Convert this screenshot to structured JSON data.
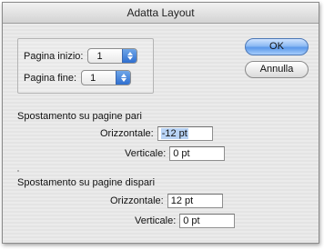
{
  "window": {
    "title": "Adatta Layout"
  },
  "page_range": {
    "start_label": "Pagina inizio:",
    "start_value": "1",
    "end_label": "Pagina fine:",
    "end_value": "1"
  },
  "buttons": {
    "ok": "OK",
    "cancel": "Annulla"
  },
  "even_pages": {
    "title": "Spostamento su pagine pari",
    "horizontal_label": "Orizzontale:",
    "horizontal_value": "-12 pt",
    "vertical_label": "Verticale:",
    "vertical_value": "0 pt"
  },
  "odd_pages": {
    "title": "Spostamento su pagine dispari",
    "horizontal_label": "Orizzontale:",
    "horizontal_value": "12 pt",
    "vertical_label": "Verticale:",
    "vertical_value": "0 pt"
  },
  "colors": {
    "default_button": "#5b98ea",
    "selection": "#b8d3f5",
    "popup_arrow": "#2f6fd0"
  }
}
